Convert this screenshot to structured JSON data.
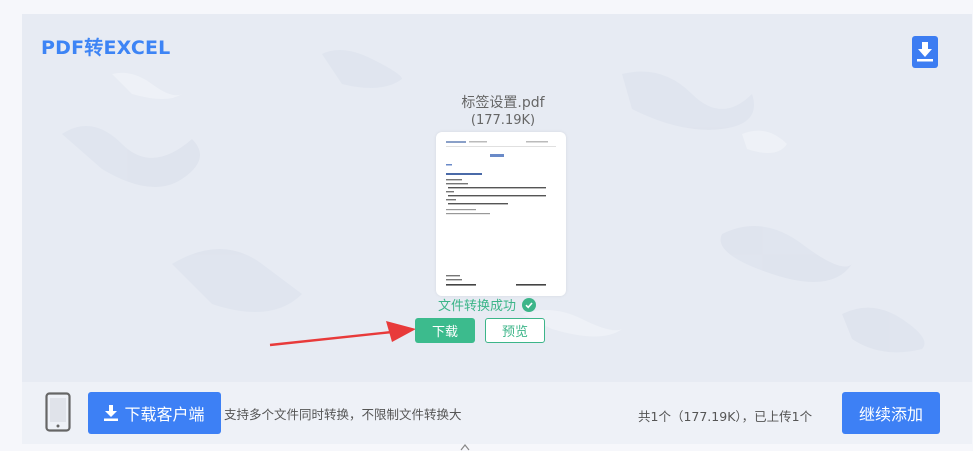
{
  "converter": {
    "title": "PDF转EXCEL",
    "download_icon": "download-icon"
  },
  "file": {
    "name": "标签设置.pdf",
    "size": "(177.19K)",
    "status": "文件转换成功",
    "status_icon": "check-circle-icon"
  },
  "actions": {
    "download_label": "下载",
    "preview_label": "预览"
  },
  "footer": {
    "phone_icon": "mobile-phone-icon",
    "client_button_label": "下载客户端",
    "client_button_icon": "download-icon",
    "tip": "支持多个文件同时转换，不限制文件转换大",
    "count": "共1个（177.19K），已上传1个",
    "continue_label": "继续添加"
  },
  "colors": {
    "brand_blue": "#3d80f5",
    "success_green": "#3cb589",
    "arrow_red": "#e83a3a",
    "panel_bg": "#e7ebf3"
  }
}
